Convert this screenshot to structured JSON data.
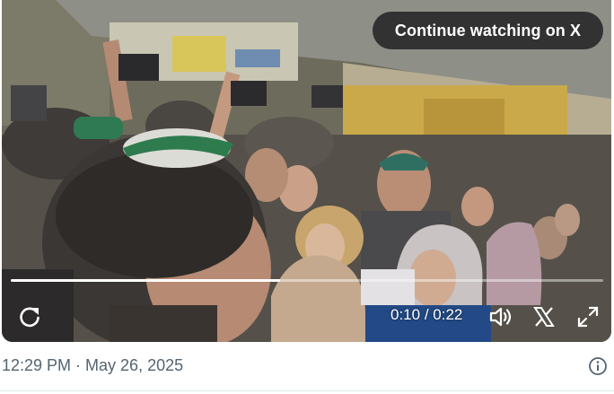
{
  "video": {
    "continue_label": "Continue watching on X",
    "current_time": "0:10",
    "duration": "0:22",
    "time_separator": "/",
    "progress_fraction": 0.4545,
    "icons": {
      "replay": "replay-icon",
      "volume": "volume-icon",
      "x_logo": "x-logo-icon",
      "fullscreen": "expand-icon"
    }
  },
  "footer": {
    "timestamp": "12:29 PM · May 26, 2025",
    "info_icon": "info-icon"
  },
  "colors": {
    "pill_bg": "#262628",
    "timestamp_text": "#536471",
    "progress_fill": "#ffffff"
  }
}
